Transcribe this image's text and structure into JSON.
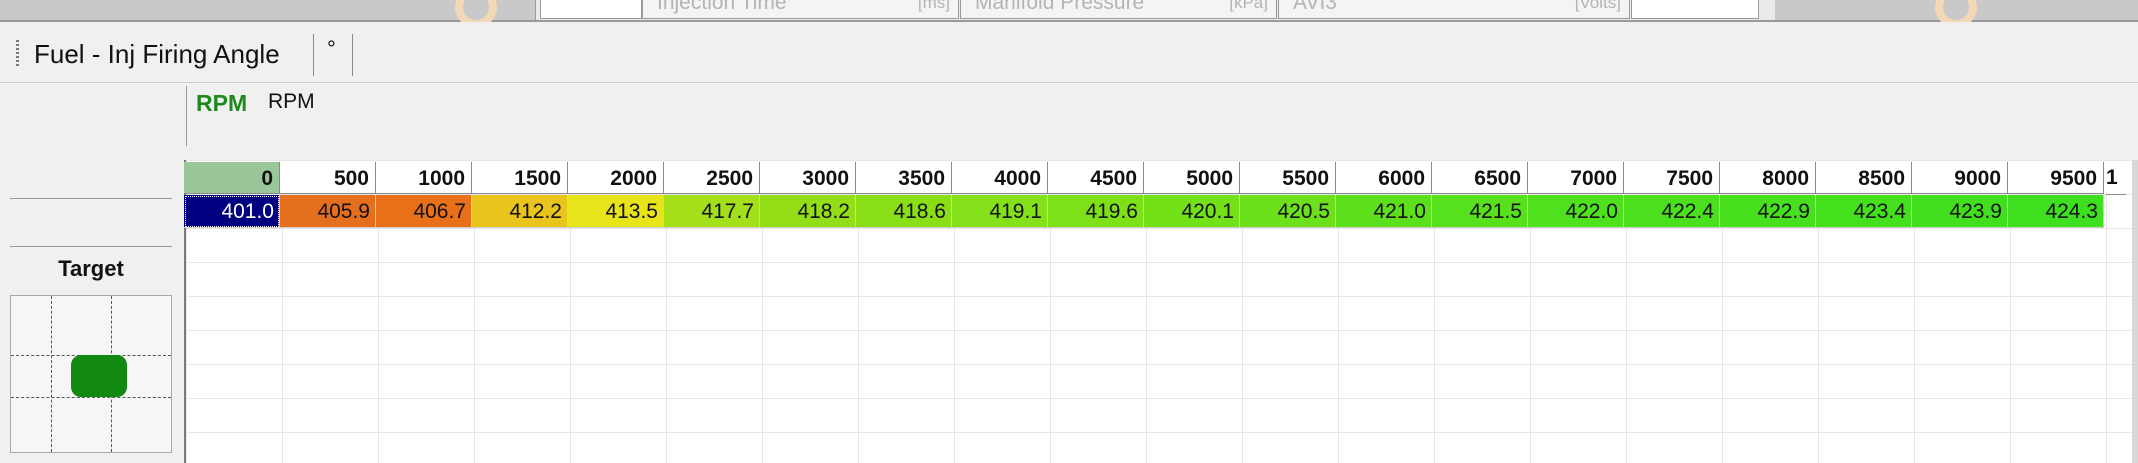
{
  "top_channels": [
    {
      "name": "Injection Time",
      "unit": "[ms]"
    },
    {
      "name": "Manifold Pressure",
      "unit": "[kPa]"
    },
    {
      "name": "AVI3",
      "unit": "[Volts]"
    }
  ],
  "table": {
    "title": "Fuel - Inj Firing Angle",
    "unit": "°",
    "axis": {
      "short_name": "RPM",
      "name": "RPM"
    },
    "target_label": "Target",
    "columns": [
      "0",
      "500",
      "1000",
      "1500",
      "2000",
      "2500",
      "3000",
      "3500",
      "4000",
      "4500",
      "5000",
      "5500",
      "6000",
      "6500",
      "7000",
      "7500",
      "8000",
      "8500",
      "9000",
      "9500"
    ],
    "overflow_header": "1",
    "values": [
      "401.0",
      "405.9",
      "406.7",
      "412.2",
      "413.5",
      "417.7",
      "418.2",
      "418.6",
      "419.1",
      "419.6",
      "420.1",
      "420.5",
      "421.0",
      "421.5",
      "422.0",
      "422.4",
      "422.9",
      "423.4",
      "423.9",
      "424.3"
    ],
    "cell_colors": [
      "#000080",
      "#e66f1e",
      "#e87019",
      "#e8c41c",
      "#e8e41a",
      "#a4e01a",
      "#94de18",
      "#8ade16",
      "#84e018",
      "#7ee118",
      "#72e118",
      "#6ce01a",
      "#5ce01c",
      "#56e11c",
      "#4fe01e",
      "#4ae01e",
      "#48e01e",
      "#44e01e",
      "#42df1e",
      "#3edf1e"
    ],
    "selected_column": 0,
    "header_selected_color": "#9ac79a",
    "axis_color": "#1e8a1e",
    "target_color": "#128a12"
  }
}
